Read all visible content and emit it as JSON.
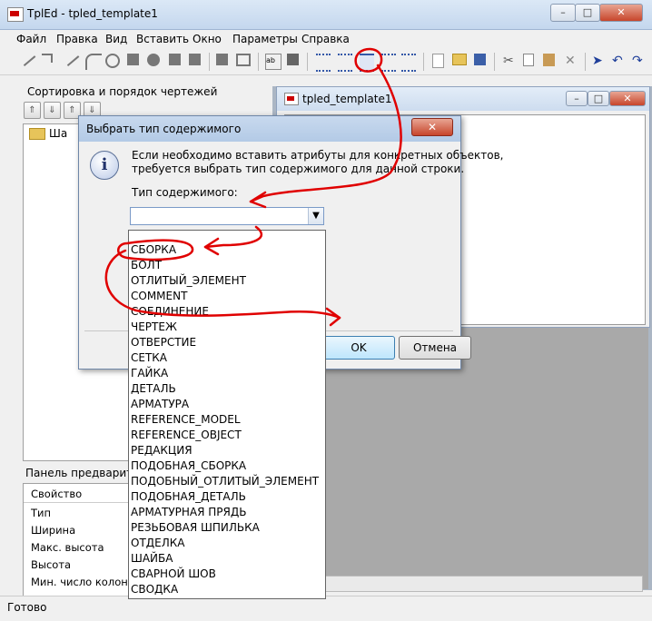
{
  "app": {
    "title": "TplEd - tpled_template1",
    "status": "Готово"
  },
  "menu": [
    "Файл",
    "Правка",
    "Вид",
    "Вставить",
    "Окно",
    "Параметры",
    "Справка"
  ],
  "left_panel": {
    "sort_title": "Сортировка и порядок чертежей",
    "tree_item": "Ша"
  },
  "preview_panel": {
    "title": "Панель предварител",
    "header": "Свойство",
    "rows": [
      "Тип",
      "Ширина",
      "Макс. высота",
      "Высота",
      "Мин. число колоно"
    ]
  },
  "child_window": {
    "title": "tpled_template1"
  },
  "dialog": {
    "title": "Выбрать тип содержимого",
    "message_line1": "Если необходимо вставить атрибуты для конкретных объектов,",
    "message_line2": "требуется выбрать тип содержимого для данной строки.",
    "type_label": "Тип содержимого:",
    "combo_value": "",
    "ok": "OK",
    "cancel": "Отмена"
  },
  "dropdown_options": [
    "СБОРКА",
    "БОЛТ",
    "ОТЛИТЫЙ_ЭЛЕМЕНТ",
    "COMMENT",
    "СОЕДИНЕНИЕ",
    "ЧЕРТЕЖ",
    "ОТВЕРСТИЕ",
    "СЕТКА",
    "ГАЙКА",
    "ДЕТАЛЬ",
    "АРМАТУРА",
    "REFERENCE_MODEL",
    "REFERENCE_OBJECT",
    "РЕДАКЦИЯ",
    "ПОДОБНАЯ_СБОРКА",
    "ПОДОБНЫЙ_ОТЛИТЫЙ_ЭЛЕМЕНТ",
    "ПОДОБНАЯ_ДЕТАЛЬ",
    "АРМАТУРНАЯ ПРЯДЬ",
    "РЕЗЬБОВАЯ ШПИЛЬКА",
    "ОТДЕЛКА",
    "ШАЙБА",
    "СВАРНОЙ ШОВ",
    "СВОДКА"
  ],
  "colors": {
    "annotation": "#e00000",
    "titlebar": "#c4d7ee"
  },
  "icons": [
    "app-icon",
    "info-icon",
    "chevron-down-icon",
    "minimize-icon",
    "maximize-icon",
    "close-icon"
  ]
}
